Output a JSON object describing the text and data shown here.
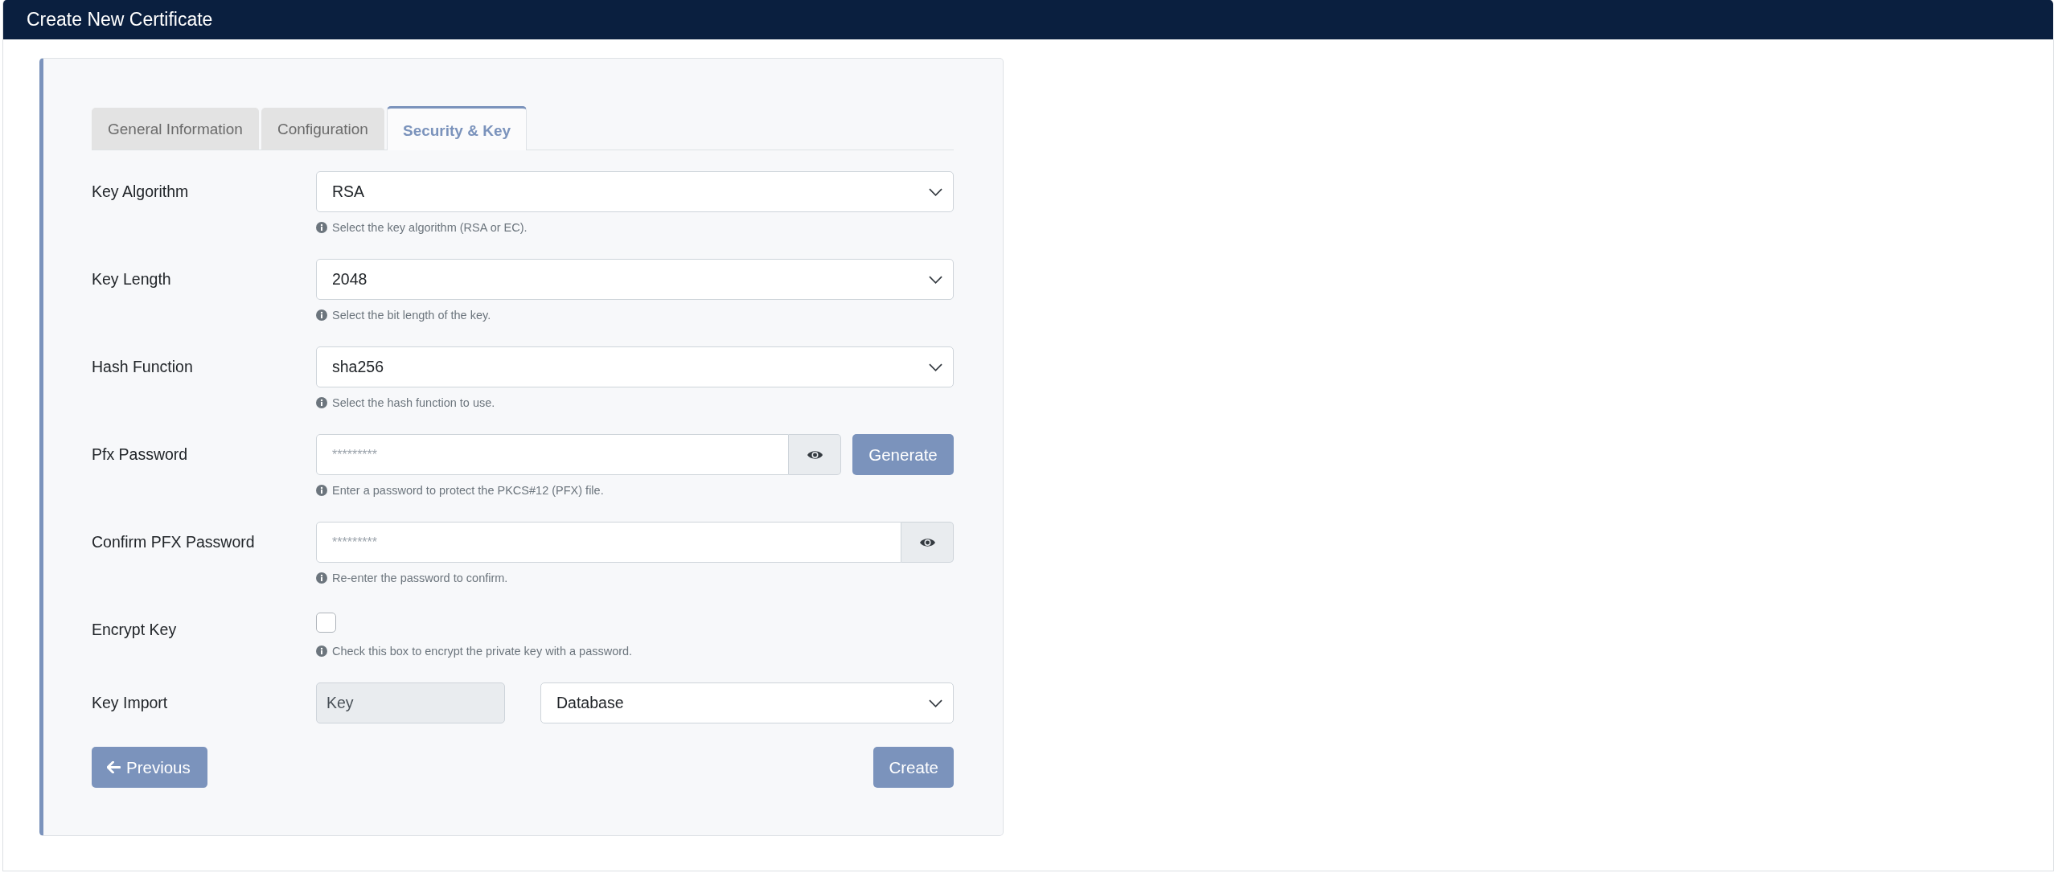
{
  "header": {
    "title": "Create New Certificate"
  },
  "tabs": [
    {
      "label": "General Information",
      "selected": false
    },
    {
      "label": "Configuration",
      "selected": false
    },
    {
      "label": "Security & Key",
      "selected": true
    }
  ],
  "fields": [
    {
      "kind": "select",
      "label": "Key Algorithm",
      "value": "RSA",
      "help": "Select the key algorithm (RSA or EC)."
    },
    {
      "kind": "select",
      "label": "Key Length",
      "value": "2048",
      "help": "Select the bit length of the key."
    },
    {
      "kind": "select",
      "label": "Hash Function",
      "value": "sha256",
      "help": "Select the hash function to use."
    },
    {
      "kind": "password",
      "label": "Pfx Password",
      "placeholder": "*********",
      "button": "Generate",
      "help": "Enter a password to protect the PKCS#12 (PFX) file."
    },
    {
      "kind": "password",
      "label": "Confirm PFX Password",
      "placeholder": "*********",
      "help": "Re-enter the password to confirm."
    },
    {
      "kind": "checkbox",
      "label": "Encrypt Key",
      "checked": false,
      "help": "Check this box to encrypt the private key with a password."
    },
    {
      "kind": "import",
      "label": "Key Import",
      "source": "Key",
      "value": "Database"
    }
  ],
  "actions": {
    "previous": "Previous",
    "create": "Create"
  }
}
